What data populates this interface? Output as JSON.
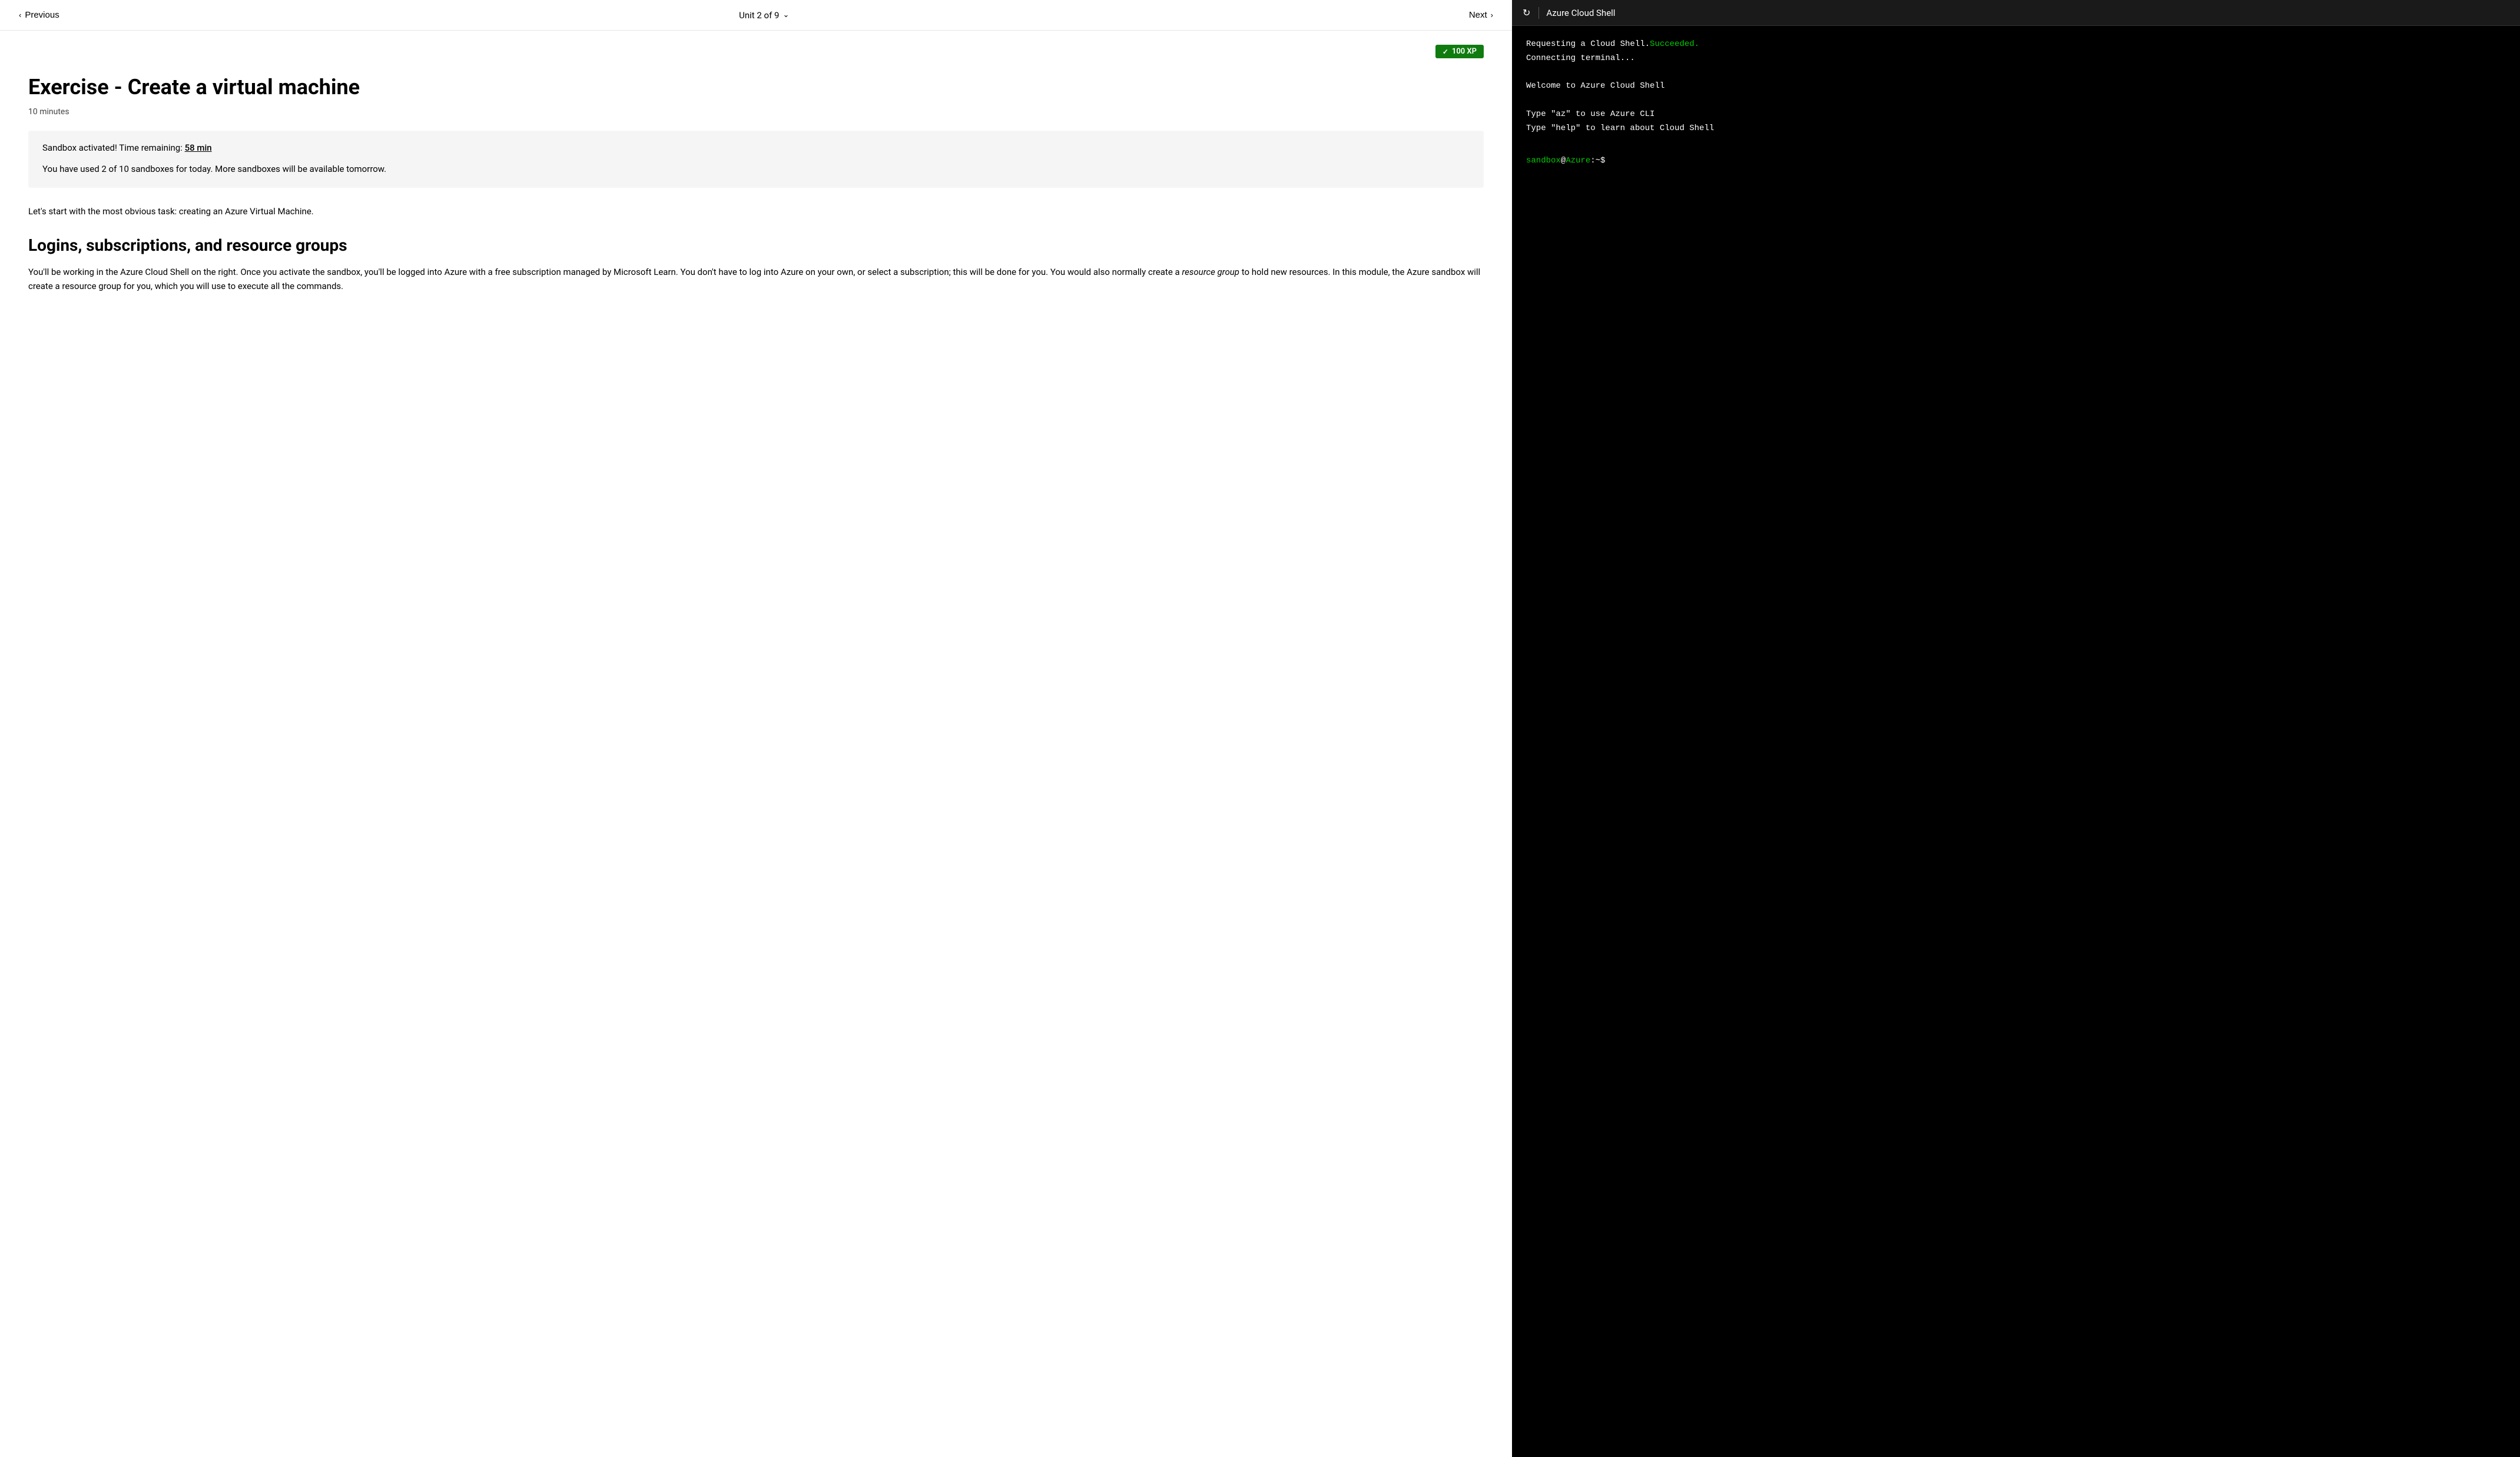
{
  "nav": {
    "previous_label": "Previous",
    "next_label": "Next",
    "unit_indicator": "Unit 2 of 9"
  },
  "xp_badge": {
    "label": "100 XP",
    "checkmark": "✓"
  },
  "article": {
    "title": "Exercise - Create a virtual machine",
    "meta_time": "10 minutes",
    "sandbox_time_label": "Sandbox activated! Time remaining:",
    "sandbox_time_value": "58 min",
    "sandbox_quota": "You have used 2 of 10 sandboxes for today. More sandboxes will be available tomorrow.",
    "intro_text": "Let's start with the most obvious task: creating an Azure Virtual Machine.",
    "section1_heading": "Logins, subscriptions, and resource groups",
    "section1_body": "You'll be working in the Azure Cloud Shell on the right. Once you activate the sandbox, you'll be logged into Azure with a free subscription managed by Microsoft Learn. You don't have to log into Azure on your own, or select a subscription; this will be done for you. You would also normally create a resource group to hold new resources. In this module, the Azure sandbox will create a resource group for you, which you will use to execute all the commands."
  },
  "shell": {
    "title": "Azure Cloud Shell",
    "refresh_icon": "↻",
    "terminal_lines": [
      {
        "type": "normal",
        "text": "Requesting a Cloud Shell.",
        "suffix": "Succeeded.",
        "suffix_color": "green"
      },
      {
        "type": "normal",
        "text": "Connecting terminal..."
      },
      {
        "type": "blank"
      },
      {
        "type": "normal",
        "text": "Welcome to Azure Cloud Shell"
      },
      {
        "type": "blank"
      },
      {
        "type": "normal",
        "text": "Type \"az\" to use Azure CLI"
      },
      {
        "type": "normal",
        "text": "Type \"help\" to learn about Cloud Shell"
      }
    ],
    "prompt": {
      "sandbox": "sandbox",
      "at": "@",
      "azure": "Azure",
      "rest": ":~$"
    }
  }
}
